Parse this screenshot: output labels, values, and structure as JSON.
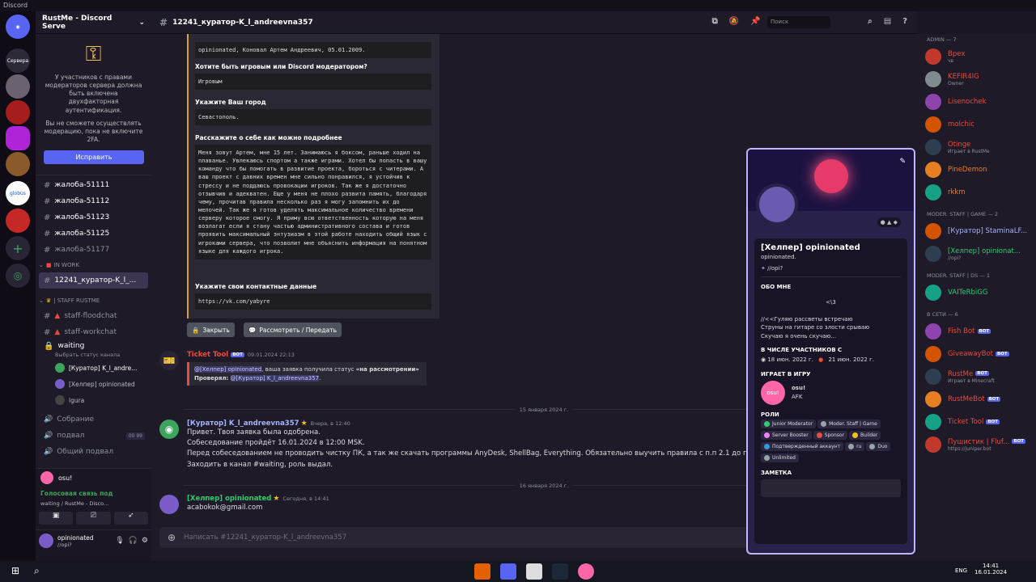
{
  "app": {
    "title": "Discord"
  },
  "guild": {
    "name": "RustMe - Discord Serve",
    "servers_label": "Сервера",
    "globus_label": "globus"
  },
  "twofa": {
    "text": "У участников с правами модераторов сервера должна быть включена двухфакторная аутентификация.",
    "note": "Вы не сможете осуществлять модерацию, пока не включите 2FA.",
    "button": "Исправить"
  },
  "channels": [
    {
      "name": "жалоба-51111",
      "dim": false
    },
    {
      "name": "жалоба-51112",
      "dim": false
    },
    {
      "name": "жалоба-51123",
      "dim": false
    },
    {
      "name": "жалоба-51125",
      "dim": false
    },
    {
      "name": "жалоба-51177",
      "dim": true
    }
  ],
  "category_inwork": "IN WORK",
  "selected_channel": "12241_куратор-K_l_...",
  "category_staff": "| STAFF RUSTME",
  "staff_channels": [
    "staff-floodchat",
    "staff-workchat"
  ],
  "waiting": {
    "name": "waiting",
    "status": "Выбрать статус канала",
    "users": [
      "[Куратор] K_l_andre...",
      "[Хелпер] opinionated",
      "lgura"
    ]
  },
  "voice_channels": [
    "Собрание",
    "подвал",
    "Общий подвал"
  ],
  "voice_counts": [
    "00",
    "99"
  ],
  "voice_panel": {
    "activity": "osu!",
    "status": "Голосовая связь под",
    "substatus": "waiting / RustMe - Disco..."
  },
  "user": {
    "name": "opinionated",
    "status": "//opi?"
  },
  "header": {
    "channel": "12241_куратор-K_l_andreevna357",
    "search": "Поиск"
  },
  "embed": {
    "fields": [
      {
        "q": "",
        "a": "opinionated, Коновал Артем Андреевич, 05.01.2009."
      },
      {
        "q": "Хотите быть игровым или Discord модератором?",
        "a": "Игровым"
      },
      {
        "q": "Укажите Ваш город",
        "a": "Севастополь."
      },
      {
        "q": "Расскажите о себе как можно подробнее",
        "a": "Меня зовут Артем, мне 15 лет. Занимаюсь я боксом, раньше ходил на плаванье. Увлекаюсь спортом а также играми. Хотел бы попасть в вашу команду что бы помогать в развитие проекта, бороться с читерами. А ваш проект с давних времен мне сильно понравился, я устойчив к стрессу и не поддаюсь провокации игроков. Так же я достаточно отзывчив и адекватен. Еще у меня не плохо развита память, благодаря чему, прочитав правила несколько раз я могу запомнить их до мелочей. Так же я готов уделять максимальное количество времени серверу которое смогу. Я приму всю ответственность которую на меня возлагат если я стану частью административного состава и готов проявить максимальный энтузиазм в этой работе находить общий язык с игроками сервера, что позволит мне объяснить информация на понятном языке для каждого игрока."
      },
      {
        "q": "Укажите свои контактные данные",
        "a": "https://vk.com/yabyre"
      }
    ],
    "btn_close": "Закрыть",
    "btn_review": "Рассмотреть / Передать"
  },
  "messages": {
    "ticket": {
      "author": "Ticket Tool",
      "bot": "BOT",
      "time": "09.01.2024 22:13",
      "mention": "@[Хелпер] opinionated",
      "text": ", ваша заявка получила статус",
      "status": "«на рассмотрении»",
      "checked_label": "Проверял:",
      "checked_by": "@[Куратор] K_l_andreevna357",
      "end": "."
    },
    "divider1": "15 января 2024 г.",
    "curator": {
      "author": "[Куратор] K_l_andreevna357",
      "time": "Вчера, в 12:40",
      "lines": [
        "Привет. Твоя заявка была одобрена.",
        "Собеседование пройдёт 16.01.2024 в 12:00 MSK.",
        "Перед собеседованием не проводить чистку ПК, а так же скачать программы AnyDesk, ShellBag, Everything. Обязательно выучить правила с п.п 2.1 до п.п 4.2.",
        "Заходить в канал #waiting, роль выдал."
      ]
    },
    "divider2": "16 января 2024 г.",
    "helper": {
      "author": "[Хелпер] opinionated",
      "time": "Сегодня, в 14:41",
      "text": "acabokok@gmail.com"
    },
    "input_placeholder": "Написать #12241_куратор-K_l_andreevna357"
  },
  "members": {
    "groups": [
      {
        "label": "ADMIN — 7",
        "items": [
          {
            "name": "Врех",
            "status": "чв",
            "color": "#e74c3c"
          },
          {
            "name": "KEFIR4IG",
            "status": "Owner",
            "color": "#e74c3c"
          },
          {
            "name": "Lisenochek",
            "status": "",
            "color": "#e74c3c"
          },
          {
            "name": "molchic",
            "status": "",
            "color": "#e74c3c"
          },
          {
            "name": "Otinge",
            "status": "Играет в RustMe",
            "color": "#e74c3c"
          },
          {
            "name": "PineDemon",
            "status": "",
            "color": "#e67e22"
          },
          {
            "name": "rkkm",
            "status": "",
            "color": "#e67e22"
          }
        ]
      },
      {
        "label": "MODER. STAFF | GAME — 2",
        "items": [
          {
            "name": "[Куратор] StaminaLF...",
            "status": "",
            "color": "#a5b4fc"
          },
          {
            "name": "[Хелпер] opinionat...",
            "status": "//opi?",
            "color": "#2ecc71"
          }
        ]
      },
      {
        "label": "MODER. STAFF | DS — 1",
        "items": [
          {
            "name": "VAITeRbiGG",
            "status": "",
            "color": "#2ecc71"
          }
        ]
      },
      {
        "label": "В СЕТИ — 6",
        "items": [
          {
            "name": "Fish Bot",
            "status": "",
            "color": "#e74c3c",
            "bot": "BOT"
          },
          {
            "name": "GiveawayBot",
            "status": "",
            "color": "#e74c3c",
            "bot": "BOT"
          },
          {
            "name": "RustMe",
            "status": "Играет в Minecraft",
            "color": "#e74c3c",
            "bot": "BOT"
          },
          {
            "name": "RustMeBot",
            "status": "",
            "color": "#e74c3c",
            "bot": "BOT"
          },
          {
            "name": "Ticket Tool",
            "status": "",
            "color": "#e74c3c",
            "bot": "BOT"
          },
          {
            "name": "Пушистик | Fluf...",
            "status": "https://juniper.bot",
            "color": "#e74c3c",
            "bot": "BOT"
          }
        ]
      }
    ]
  },
  "profile": {
    "display_name": "[Хелпер] opinionated",
    "username": "opinionated.",
    "custom_status": "//opi?",
    "about_title": "ОБО МНЕ",
    "about": [
      "<\\3",
      "//<<Гуляю рассветы встречаю",
      "Струны на гитаре со злости срываю",
      "Скучаю я очень скучаю..."
    ],
    "member_since_title": "В ЧИСЛЕ УЧАСТНИКОВ С",
    "discord_since": "18 июн. 2022 г.",
    "server_since": "21 июн. 2022 г.",
    "playing_title": "ИГРАЕТ В ИГРУ",
    "game": "osu!",
    "game_status": "AFK",
    "roles_title": "РОЛИ",
    "roles": [
      {
        "name": "Junior Moderator",
        "color": "#2ecc71"
      },
      {
        "name": "Moder. Staff | Game",
        "color": "#95a5a6"
      },
      {
        "name": "Server Booster",
        "color": "#f47fff"
      },
      {
        "name": "Sponsor",
        "color": "#e74c3c"
      },
      {
        "name": "Builder",
        "color": "#f1c40f"
      },
      {
        "name": "Подтвержденный аккаунт",
        "color": "#3498db"
      },
      {
        "name": "ru",
        "color": "#95a5a6"
      },
      {
        "name": "Duo",
        "color": "#95a5a6"
      },
      {
        "name": "Unlimited",
        "color": "#95a5a6"
      }
    ],
    "note_title": "ЗАМЕТКА"
  },
  "taskbar": {
    "lang": "ENG",
    "time": "14:41",
    "date": "16.01.2024"
  }
}
